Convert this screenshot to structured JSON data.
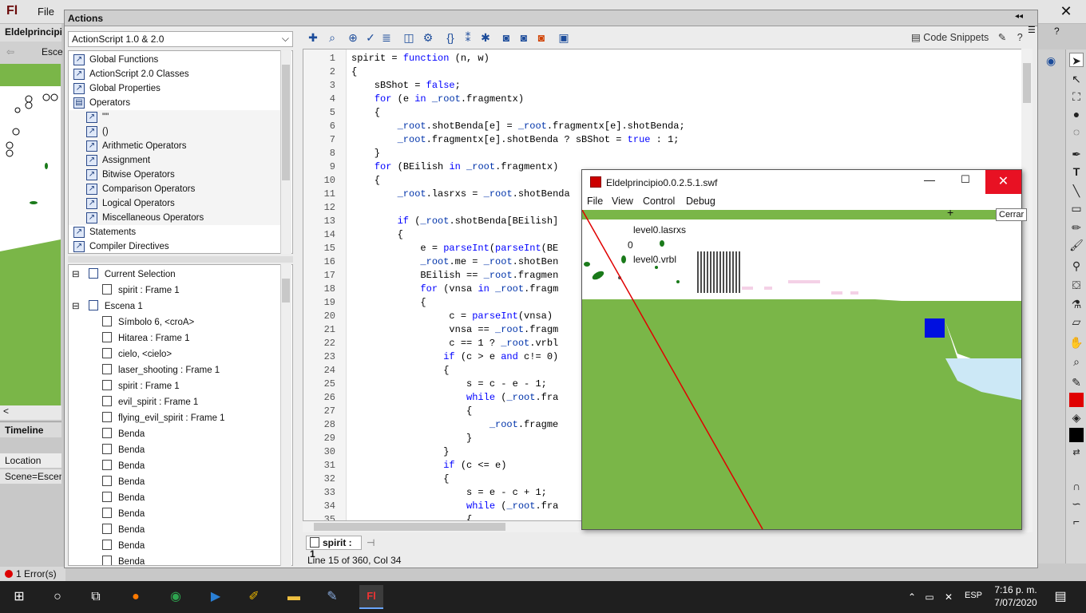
{
  "app": {
    "logo": "Fl",
    "file_menu": "File",
    "close": "✕",
    "help": "?"
  },
  "doc": {
    "tab": "Eldelprincipio",
    "scene_short": "Esce",
    "timeline": "Timeline",
    "location": "Location",
    "scene_value": "Scene=Escen",
    "errors": "1 Error(s)"
  },
  "actions": {
    "title": "Actions",
    "language": "ActionScript 1.0 & 2.0",
    "toolbox": [
      "Global Functions",
      "ActionScript 2.0 Classes",
      "Global Properties",
      "Operators",
      "\"\"",
      "()",
      "Arithmetic Operators",
      "Assignment",
      "Bitwise Operators",
      "Comparison Operators",
      "Logical Operators",
      "Miscellaneous Operators",
      "Statements",
      "Compiler Directives"
    ],
    "tree": [
      {
        "label": "Current Selection",
        "indent": 0
      },
      {
        "label": "spirit : Frame 1",
        "indent": 1
      },
      {
        "label": "Escena 1",
        "indent": 0
      },
      {
        "label": "Símbolo 6, <croA>",
        "indent": 1
      },
      {
        "label": "Hitarea : Frame 1",
        "indent": 1
      },
      {
        "label": "cielo, <cielo>",
        "indent": 1
      },
      {
        "label": "laser_shooting : Frame 1",
        "indent": 1
      },
      {
        "label": "spirit : Frame 1",
        "indent": 1
      },
      {
        "label": "evil_spirit : Frame 1",
        "indent": 1
      },
      {
        "label": "flying_evil_spirit : Frame 1",
        "indent": 1
      },
      {
        "label": "Benda",
        "indent": 1
      },
      {
        "label": "Benda",
        "indent": 1
      },
      {
        "label": "Benda",
        "indent": 1
      },
      {
        "label": "Benda",
        "indent": 1
      },
      {
        "label": "Benda",
        "indent": 1
      },
      {
        "label": "Benda",
        "indent": 1
      },
      {
        "label": "Benda",
        "indent": 1
      },
      {
        "label": "Benda",
        "indent": 1
      },
      {
        "label": "Benda",
        "indent": 1
      }
    ],
    "code_snippets": "Code Snippets",
    "script_tab": "spirit : 1",
    "status": "Line 15 of 360, Col 34"
  },
  "code": [
    "spirit = function (n, w)",
    "{",
    "    sBShot = false;",
    "    for (e in _root.fragmentx)",
    "    {",
    "        _root.shotBenda[e] = _root.fragmentx[e].shotBenda;",
    "        _root.fragmentx[e].shotBenda ? sBShot = true : 1;",
    "    }",
    "    for (BEilish in _root.fragmentx)",
    "    {",
    "        _root.lasrxs = _root.shotBenda",
    "",
    "        if (_root.shotBenda[BEilish]",
    "        {",
    "            e = parseInt(parseInt(BE",
    "            _root.me = _root.shotBen",
    "            BEilish == _root.fragmen",
    "            for (vnsa in _root.fragm",
    "            {",
    "                 c = parseInt(vnsa)",
    "                 vnsa == _root.fragm",
    "                 c == 1 ? _root.vrbl",
    "                if (c > e and c!= 0)",
    "                {",
    "                    s = c - e - 1;",
    "                    while (_root.fra",
    "                    {",
    "                        _root.fragme",
    "                    }",
    "                }",
    "                if (c <= e)",
    "                {",
    "                    s = e - c + 1;",
    "                    while (_root.fra",
    "                    {"
  ],
  "swf": {
    "title": "Eldelprincipio0.0.2.5.1.swf",
    "menu": [
      "File",
      "View",
      "Control",
      "Debug"
    ],
    "min": "—",
    "max": "☐",
    "close": "✕",
    "label1": "level0.lasrxs",
    "label2": "0",
    "label3": "level0.vrbl",
    "tooltip": "Cerrar"
  },
  "taskbar": {
    "time": "7:16 p. m.",
    "date": "7/07/2020",
    "lang": "ESP"
  }
}
